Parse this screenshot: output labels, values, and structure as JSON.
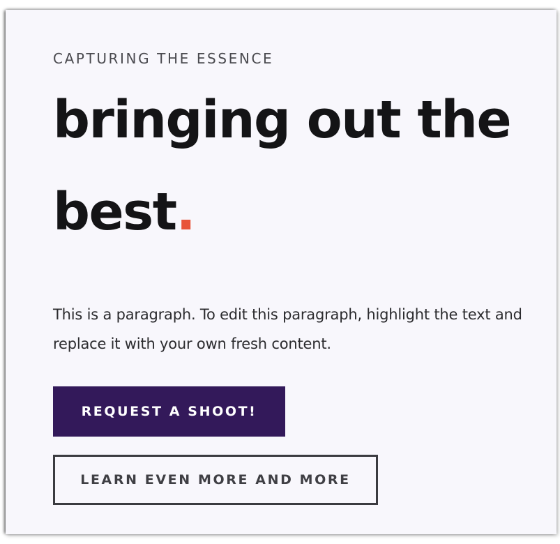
{
  "hero": {
    "eyebrow": "CAPTURING THE ESSENCE",
    "headline_line1": "bringing out the",
    "headline_line2": "best",
    "headline_punct": ".",
    "paragraph": "This is a paragraph. To edit this paragraph, highlight the text and replace it with your own fresh content.",
    "primary_button": "REQUEST A SHOOT!",
    "secondary_button": "LEARN EVEN MORE AND MORE"
  },
  "colors": {
    "accent": "#e8543a",
    "primary_button_bg": "#33195a",
    "background": "#f8f7fc",
    "text_dark": "#141416"
  }
}
